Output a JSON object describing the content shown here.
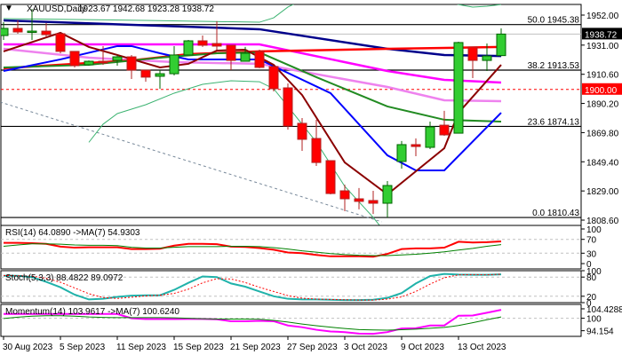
{
  "header": {
    "symbol": "XAUUSD,Daily",
    "ohlc": "1923.67 1942.68 1923.28 1938.72"
  },
  "colors": {
    "bull": "#32cd32",
    "bear": "#ff0000",
    "current_price_bg": "#000000",
    "level_bg": "#ff0000"
  },
  "chart_data": {
    "type": "candlestick",
    "title": "XAUUSD,Daily",
    "ylim": [
      1808.6,
      1952.0
    ],
    "y_ticks": [
      "1952.00",
      "1931.00",
      "1910.60",
      "1890.20",
      "1869.80",
      "1849.40",
      "1829.00",
      "1808.60"
    ],
    "y_tick_values": [
      1952.0,
      1931.0,
      1910.6,
      1890.2,
      1869.8,
      1849.4,
      1829.0,
      1808.6
    ],
    "current_price": {
      "value": 1938.72,
      "label": "1938.72"
    },
    "key_level": {
      "value": 1900.0,
      "label": "1900.00"
    },
    "fib_levels": [
      {
        "value": 1945.38,
        "label": "50.0 1945.38"
      },
      {
        "value": 1913.53,
        "label": "38.2 1913.53"
      },
      {
        "value": 1874.13,
        "label": "23.6 1874.13"
      },
      {
        "value": 1810.43,
        "label": "0.0 1810.43"
      }
    ],
    "x_labels": [
      {
        "index": 0,
        "label": "30 Aug 2023"
      },
      {
        "index": 4,
        "label": "5 Sep 2023"
      },
      {
        "index": 8,
        "label": "11 Sep 2023"
      },
      {
        "index": 12,
        "label": "15 Sep 2023"
      },
      {
        "index": 16,
        "label": "21 Sep 2023"
      },
      {
        "index": 20,
        "label": "27 Sep 2023"
      },
      {
        "index": 24,
        "label": "3 Oct 2023"
      },
      {
        "index": 28,
        "label": "9 Oct 2023"
      },
      {
        "index": 32,
        "label": "13 Oct 2023"
      }
    ],
    "candles_ohlc": [
      [
        1937.7,
        1947.0,
        1934.6,
        1942.7
      ],
      [
        1942.7,
        1948.3,
        1939.0,
        1940.2
      ],
      [
        1940.2,
        1956.3,
        1934.6,
        1940.8
      ],
      [
        1940.8,
        1946.4,
        1936.5,
        1938.3
      ],
      [
        1939.0,
        1939.0,
        1925.3,
        1926.6
      ],
      [
        1926.6,
        1926.6,
        1915.4,
        1916.6
      ],
      [
        1917.2,
        1920.3,
        1916.6,
        1919.7
      ],
      [
        1919.7,
        1930.3,
        1917.2,
        1918.5
      ],
      [
        1920.3,
        1924.1,
        1916.6,
        1922.8
      ],
      [
        1922.8,
        1924.1,
        1907.3,
        1913.5
      ],
      [
        1913.5,
        1913.5,
        1905.4,
        1908.6
      ],
      [
        1909.2,
        1913.5,
        1900.5,
        1911.0
      ],
      [
        1911.0,
        1930.3,
        1909.8,
        1924.1
      ],
      [
        1924.1,
        1934.6,
        1924.1,
        1934.0
      ],
      [
        1934.0,
        1937.7,
        1929.7,
        1930.9
      ],
      [
        1932.1,
        1947.7,
        1927.8,
        1930.3
      ],
      [
        1930.9,
        1930.9,
        1913.5,
        1920.3
      ],
      [
        1919.7,
        1929.7,
        1919.7,
        1925.3
      ],
      [
        1926.6,
        1927.8,
        1914.8,
        1915.4
      ],
      [
        1916.0,
        1916.0,
        1898.6,
        1900.5
      ],
      [
        1901.1,
        1904.2,
        1871.9,
        1874.4
      ],
      [
        1876.3,
        1880.0,
        1857.0,
        1865.1
      ],
      [
        1865.7,
        1878.8,
        1846.5,
        1848.9
      ],
      [
        1850.2,
        1850.2,
        1826.6,
        1827.2
      ],
      [
        1829.1,
        1833.4,
        1814.8,
        1823.5
      ],
      [
        1823.5,
        1831.0,
        1816.1,
        1821.7
      ],
      [
        1822.3,
        1829.1,
        1812.9,
        1820.4
      ],
      [
        1820.4,
        1835.9,
        1810.4,
        1832.8
      ],
      [
        1849.6,
        1863.9,
        1844.6,
        1861.4
      ],
      [
        1861.4,
        1865.7,
        1853.3,
        1860.1
      ],
      [
        1859.5,
        1877.5,
        1858.3,
        1873.8
      ],
      [
        1875.0,
        1885.0,
        1867.6,
        1868.2
      ],
      [
        1869.4,
        1933.4,
        1869.4,
        1932.8
      ],
      [
        1929.7,
        1929.7,
        1907.9,
        1920.3
      ],
      [
        1920.3,
        1932.1,
        1912.9,
        1923.4
      ],
      [
        1923.67,
        1942.68,
        1923.28,
        1938.72
      ]
    ],
    "overlays": [
      {
        "name": "ma-navy",
        "color": "#00008b",
        "width": 2.5,
        "points": [
          [
            0,
            1948.3
          ],
          [
            18,
            1942.1
          ],
          [
            27,
            1928.4
          ],
          [
            31,
            1924.1
          ],
          [
            35,
            1923.4
          ]
        ]
      },
      {
        "name": "ma-magenta",
        "color": "#ff00ff",
        "width": 2.5,
        "points": [
          [
            0,
            1931.5
          ],
          [
            18,
            1931.5
          ],
          [
            27,
            1912.9
          ],
          [
            31,
            1906.7
          ],
          [
            35,
            1904.8
          ]
        ]
      },
      {
        "name": "ma-violet",
        "color": "#ee82ee",
        "width": 2.5,
        "points": [
          [
            0,
            1928.4
          ],
          [
            6,
            1922.2
          ],
          [
            12,
            1919.1
          ],
          [
            18,
            1917.9
          ],
          [
            27,
            1901.7
          ],
          [
            31,
            1892.4
          ],
          [
            35,
            1891.8
          ]
        ]
      },
      {
        "name": "ma-red",
        "color": "#ff0000",
        "width": 2.5,
        "points": [
          [
            0,
            1914.8
          ],
          [
            9,
            1920.3
          ],
          [
            13,
            1924.7
          ],
          [
            18,
            1926.6
          ],
          [
            27,
            1928.4
          ],
          [
            35,
            1929.7
          ]
        ]
      },
      {
        "name": "ma-green",
        "color": "#228b22",
        "width": 2,
        "points": [
          [
            0,
            1915.4
          ],
          [
            6,
            1917.2
          ],
          [
            11,
            1922.2
          ],
          [
            15,
            1925.3
          ],
          [
            18,
            1925.9
          ],
          [
            22,
            1908.6
          ],
          [
            27,
            1888.1
          ],
          [
            31,
            1878.8
          ],
          [
            35,
            1877.5
          ]
        ]
      },
      {
        "name": "ma-blue",
        "color": "#0000ff",
        "width": 2,
        "points": [
          [
            0,
            1912.9
          ],
          [
            4,
            1921.0
          ],
          [
            8,
            1930.3
          ],
          [
            9,
            1930.3
          ],
          [
            11,
            1925.3
          ],
          [
            13,
            1921.0
          ],
          [
            16,
            1921.0
          ],
          [
            18,
            1921.0
          ],
          [
            23,
            1897.4
          ],
          [
            27,
            1853.9
          ],
          [
            29,
            1843.4
          ],
          [
            31,
            1843.4
          ],
          [
            35,
            1883.7
          ]
        ]
      },
      {
        "name": "ma-maroon",
        "color": "#8b0000",
        "width": 2,
        "points": [
          [
            0,
            1926.6
          ],
          [
            4,
            1939.6
          ],
          [
            6,
            1929.7
          ],
          [
            8,
            1924.1
          ],
          [
            11,
            1915.4
          ],
          [
            13,
            1917.9
          ],
          [
            15,
            1927.2
          ],
          [
            17,
            1927.8
          ],
          [
            19,
            1917.2
          ],
          [
            21,
            1896.1
          ],
          [
            24,
            1848.9
          ],
          [
            27,
            1826.6
          ],
          [
            31,
            1858.9
          ],
          [
            32,
            1883.7
          ],
          [
            35,
            1917.2
          ]
        ]
      },
      {
        "name": "bollinger-upper",
        "color": "#3cb371",
        "width": 1,
        "points": [
          [
            0,
            1949.5
          ],
          [
            10,
            1948.3
          ],
          [
            18,
            1947.0
          ],
          [
            19,
            1950.1
          ],
          [
            20,
            1957.6
          ],
          [
            21,
            1962.6
          ],
          [
            30,
            1965.7
          ],
          [
            32,
            1959.4
          ],
          [
            33,
            1957.6
          ],
          [
            34,
            1958.2
          ],
          [
            35,
            1959.4
          ]
        ]
      },
      {
        "name": "bollinger-lower",
        "color": "#3cb371",
        "width": 1,
        "points": [
          [
            6,
            1863.0
          ],
          [
            7,
            1875.7
          ],
          [
            8,
            1883.1
          ],
          [
            10,
            1889.3
          ],
          [
            12,
            1897.4
          ],
          [
            14,
            1903.6
          ],
          [
            16,
            1906.1
          ],
          [
            18,
            1905.4
          ],
          [
            19,
            1900.5
          ],
          [
            20,
            1888.1
          ],
          [
            22,
            1863.2
          ],
          [
            24,
            1832.2
          ],
          [
            26,
            1810.5
          ],
          [
            27,
            1798.0
          ]
        ]
      }
    ],
    "trendline": {
      "color": "#778899",
      "points": [
        [
          -0.25,
          1891.2
        ],
        [
          26.6,
          1807.4
        ]
      ]
    },
    "indicators": {
      "rsi": {
        "label": "RSI(14) 64.0890  ->MA(7) 54.9303",
        "ylim": [
          0,
          100
        ],
        "levels": [
          70,
          30
        ],
        "ticks": [
          "100",
          "70",
          "30",
          "0"
        ],
        "tick_values": [
          100,
          70,
          30,
          0
        ],
        "series": [
          {
            "name": "RSI(14)",
            "color": "#ff0000",
            "values": [
              60,
              60,
              59,
              57,
              49,
              46,
              47,
              47,
              47,
              42,
              42,
              43,
              52,
              57,
              57,
              56,
              49,
              48,
              45,
              40,
              32,
              30,
              25,
              21,
              21,
              21,
              20,
              28,
              42,
              44,
              44,
              46,
              63,
              61,
              62,
              64.089
            ]
          },
          {
            "name": "MA(7)",
            "color": "#008000",
            "values": [
              50,
              54,
              57,
              57,
              56,
              54,
              53,
              53,
              52,
              47,
              45,
              45,
              47,
              49,
              49,
              49,
              50,
              50,
              49,
              46,
              42,
              37,
              33,
              29,
              26,
              24,
              23,
              23,
              25,
              27,
              30,
              34,
              39,
              44,
              50,
              54.9303
            ]
          }
        ]
      },
      "stoch": {
        "label": "Stoch(5,3,3) 88.4822 89.0972",
        "ylim": [
          0,
          100
        ],
        "levels": [
          80,
          20
        ],
        "ticks": [
          "100",
          "80",
          "20",
          "0"
        ],
        "tick_values": [
          100,
          80,
          20,
          0
        ],
        "series": [
          {
            "name": "Main",
            "color": "#20b2aa",
            "values": [
              84,
              84,
              80,
              65,
              48,
              25,
              10,
              12,
              18,
              22,
              23,
              23,
              40,
              62,
              82,
              80,
              60,
              50,
              35,
              20,
              12,
              10,
              10,
              9,
              8,
              8,
              9,
              15,
              30,
              60,
              83,
              90,
              88,
              87,
              87,
              88.4822
            ]
          },
          {
            "name": "Signal",
            "color": "#ff0000",
            "values": [
              85,
              84,
              83,
              76,
              64,
              46,
              28,
              16,
              13,
              17,
              21,
              23,
              29,
              42,
              62,
              75,
              74,
              63,
              48,
              35,
              22,
              14,
              11,
              10,
              9,
              8,
              8,
              11,
              18,
              35,
              58,
              78,
              87,
              88,
              87,
              89.0972
            ]
          }
        ]
      },
      "momentum": {
        "label": "Momentum(14) 103.9617  ->MA(7) 100.6240",
        "ylim": [
          91.5,
          106.5
        ],
        "levels": [
          100
        ],
        "ticks": [
          "104.4288",
          "100",
          "94.154"
        ],
        "tick_values": [
          104.4288,
          100,
          94.154
        ],
        "series": [
          {
            "name": "Momentum(14)",
            "color": "#ff00ff",
            "values": [
              102,
              102,
              102,
              102,
              102,
              102,
              102,
              102,
              102,
              100,
              99.6,
              99.6,
              99.6,
              99.7,
              99.7,
              99.5,
              98.6,
              98.6,
              98.8,
              98.6,
              96.6,
              95.8,
              94.6,
              93.8,
              93.5,
              92.8,
              92.7,
              93.5,
              95.2,
              95.3,
              96.6,
              96.6,
              101.2,
              101.3,
              102.6,
              103.9617
            ]
          },
          {
            "name": "MA(7)",
            "color": "#008000",
            "values": [
              99.9,
              100.5,
              101,
              101.2,
              101.2,
              101,
              100.6,
              100.4,
              100.3,
              100.3,
              100.3,
              100.3,
              100.2,
              100,
              99.8,
              99.6,
              99.6,
              99.6,
              99.5,
              99,
              98.2,
              97.3,
              96.5,
              95.8,
              95.2,
              94.7,
              94.5,
              94.4,
              94.6,
              94.9,
              95.3,
              95.7,
              96.6,
              97.9,
              99.3,
              100.624
            ]
          }
        ]
      }
    }
  }
}
